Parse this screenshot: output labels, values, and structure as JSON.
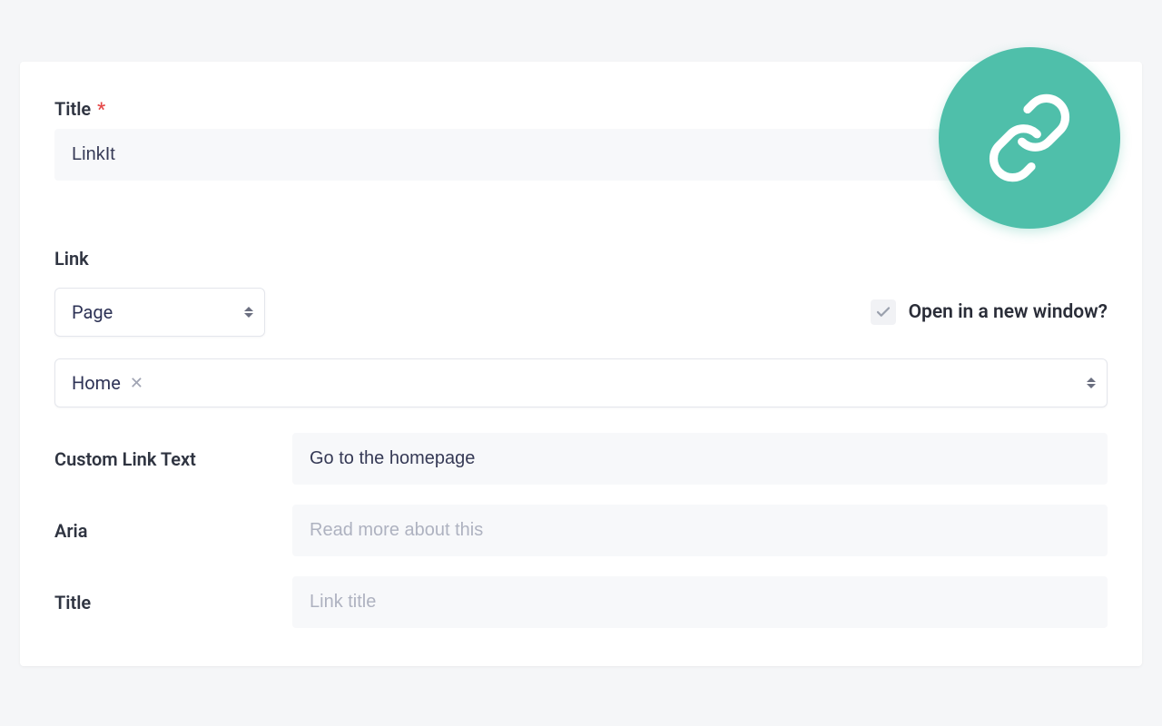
{
  "title_section": {
    "label": "Title",
    "required_marker": "*",
    "value": "LinkIt"
  },
  "link_section": {
    "label": "Link",
    "type_select": "Page",
    "open_new_window_label": "Open in a new window?",
    "page_select": "Home"
  },
  "custom_link_text": {
    "label": "Custom Link Text",
    "value": "Go to the homepage"
  },
  "aria": {
    "label": "Aria",
    "placeholder": "Read more about this"
  },
  "title_attr": {
    "label": "Title",
    "placeholder": "Link title"
  }
}
